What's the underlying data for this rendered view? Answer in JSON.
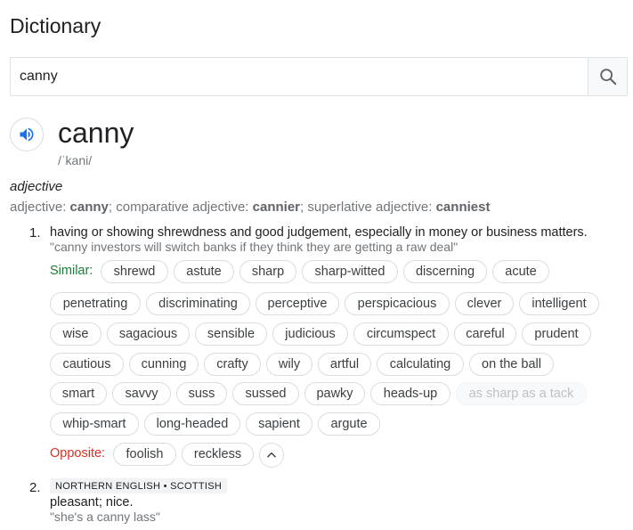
{
  "header": {
    "title": "Dictionary"
  },
  "search": {
    "value": "canny",
    "icon": "search-icon"
  },
  "entry": {
    "word": "canny",
    "phonetic": "/ˈkani/",
    "part_of_speech": "adjective",
    "forms": {
      "label1": "adjective: ",
      "base": "canny",
      "label2": "; comparative adjective: ",
      "comparative": "cannier",
      "label3": "; superlative adjective: ",
      "superlative": "canniest"
    }
  },
  "senses": [
    {
      "number": "1.",
      "definition": "having or showing shrewdness and good judgement, especially in money or business matters.",
      "example": "\"canny investors will switch banks if they think they are getting a raw deal\"",
      "similar_label": "Similar:",
      "similar": [
        "shrewd",
        "astute",
        "sharp",
        "sharp-witted",
        "discerning",
        "acute",
        "penetrating",
        "discriminating",
        "perceptive",
        "perspicacious",
        "clever",
        "intelligent",
        "wise",
        "sagacious",
        "sensible",
        "judicious",
        "circumspect",
        "careful",
        "prudent",
        "cautious",
        "cunning",
        "crafty",
        "wily",
        "artful",
        "calculating",
        "on the ball",
        "smart",
        "savvy",
        "suss",
        "sussed",
        "pawky",
        "heads-up",
        "as sharp as a tack",
        "whip-smart",
        "long-headed",
        "sapient",
        "argute"
      ],
      "opposite_label": "Opposite:",
      "opposite": [
        "foolish",
        "reckless"
      ]
    },
    {
      "number": "2.",
      "region": "NORTHERN ENGLISH • SCOTTISH",
      "definition": "pleasant; nice.",
      "example": "\"she's a canny lass\""
    }
  ],
  "colors": {
    "similar_label": "#188038",
    "opposite_label": "#d93025",
    "speaker_icon": "#1a73e8",
    "chip_border": "#dadce0"
  }
}
